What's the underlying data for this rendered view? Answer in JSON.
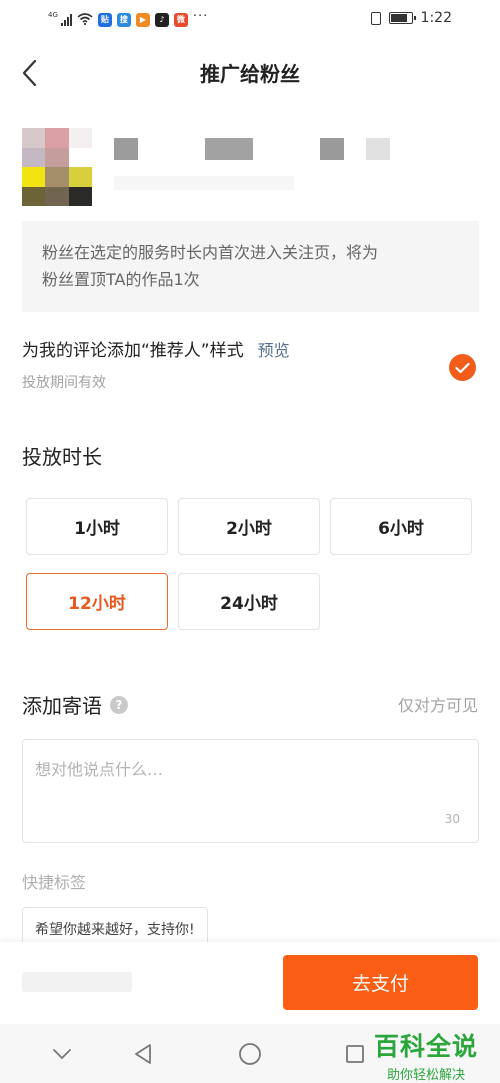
{
  "status_bar": {
    "network": "4G",
    "time": "1:22",
    "app_icons": [
      {
        "icon": "app-notification-1",
        "label": "贴",
        "color": "#1f6fe0"
      },
      {
        "icon": "app-notification-2",
        "label": "搜",
        "color": "#2b8ae0"
      },
      {
        "icon": "app-notification-3",
        "label": "▶",
        "color": "#f08a24"
      },
      {
        "icon": "app-notification-4",
        "label": "♪",
        "color": "#222222"
      },
      {
        "icon": "app-notification-5",
        "label": "微",
        "color": "#e84a2e"
      }
    ]
  },
  "header": {
    "back_icon": "chevron-left-icon",
    "title": "推广给粉丝"
  },
  "info": {
    "text_line1": "粉丝在选定的服务时长内首次进入关注页，将为",
    "text_line2": "粉丝置顶TA的作品1次"
  },
  "recommend_option": {
    "title": "为我的评论添加“推荐人”样式",
    "preview_label": "预览",
    "subtitle": "投放期间有效",
    "checked": true
  },
  "duration": {
    "title": "投放时长",
    "options": [
      {
        "label": "1小时",
        "selected": false
      },
      {
        "label": "2小时",
        "selected": false
      },
      {
        "label": "6小时",
        "selected": false
      },
      {
        "label": "12小时",
        "selected": true
      },
      {
        "label": "24小时",
        "selected": false
      }
    ]
  },
  "message": {
    "title": "添加寄语",
    "help_icon": "question-icon",
    "visibility_note": "仅对方可见",
    "placeholder": "想对他说点什么…",
    "max_length": "30"
  },
  "quick_tags": {
    "title": "快捷标签",
    "items": [
      "希望你越来越好，支持你!"
    ]
  },
  "footer": {
    "pay_label": "去支付"
  },
  "watermark": {
    "title": "百科全说",
    "subtitle": "助你轻松解决"
  },
  "colors": {
    "accent": "#fa5d14",
    "selected_border": "#e86a2f",
    "link": "#55708e",
    "watermark": "#2aa63b"
  }
}
